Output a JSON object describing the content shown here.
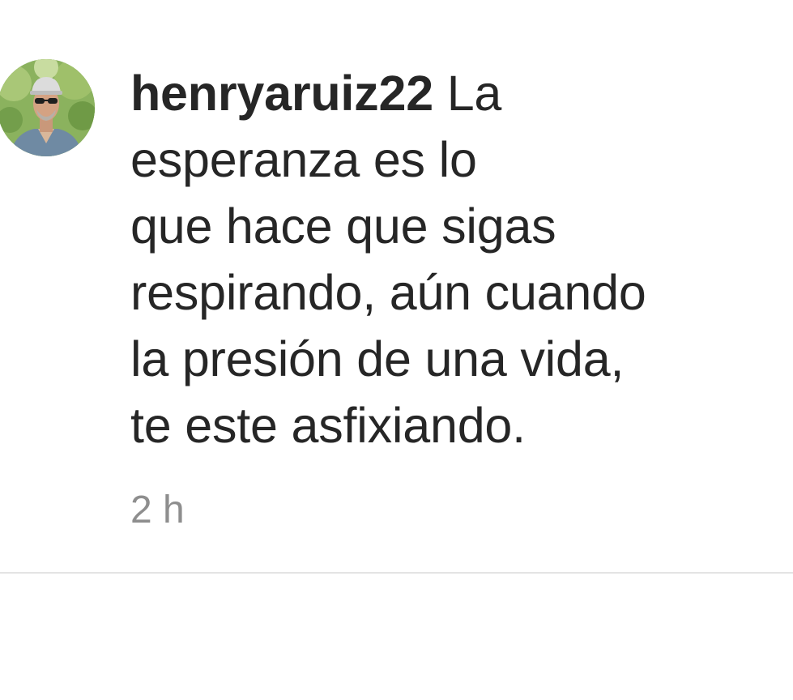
{
  "comment": {
    "username": "henryaruiz22",
    "text_lines": [
      "La",
      "esperanza es lo",
      "que hace que sigas",
      "respirando, aún cuando",
      "la presión de una vida,",
      "te este asfixiando."
    ],
    "timestamp": "2 h",
    "avatar_icon": "user-avatar"
  },
  "colors": {
    "text": "#262626",
    "muted": "#8e8e8e",
    "divider": "#e4e4e4",
    "background": "#ffffff"
  }
}
